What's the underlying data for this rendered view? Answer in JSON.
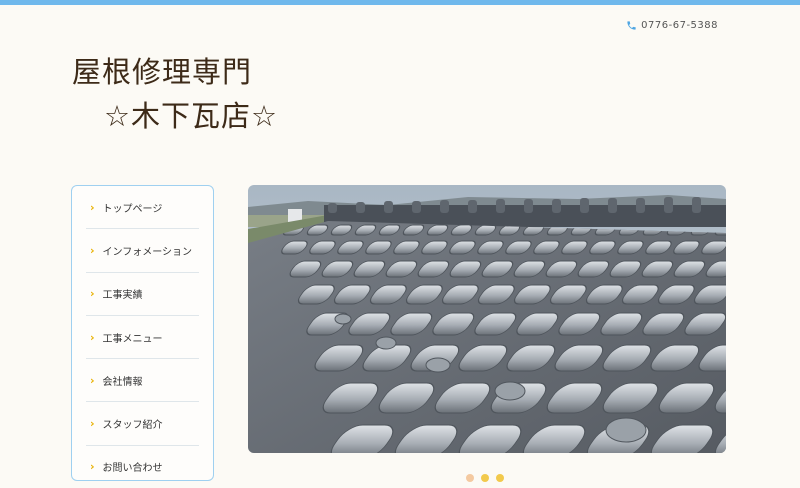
{
  "header": {
    "phone": "0776-67-5388",
    "title_line1": "屋根修理専門",
    "title_line2": "☆木下瓦店☆"
  },
  "sidebar": {
    "items": [
      {
        "label": "トップページ"
      },
      {
        "label": "インフォメーション"
      },
      {
        "label": "工事実績"
      },
      {
        "label": "工事メニュー"
      },
      {
        "label": "会社情報"
      },
      {
        "label": "スタッフ紹介"
      },
      {
        "label": "お問い合わせ"
      }
    ]
  },
  "slider": {
    "slide_count": 3,
    "active_index": 0
  },
  "colors": {
    "accent_blue": "#6fb8ec",
    "chevron": "#e8b100",
    "title_text": "#3d2a18",
    "dot_active": "#f4c9a0",
    "dot_inactive": "#f2c94c"
  },
  "icons": {
    "phone": "phone-icon",
    "chevron": "chevron-right-icon"
  }
}
